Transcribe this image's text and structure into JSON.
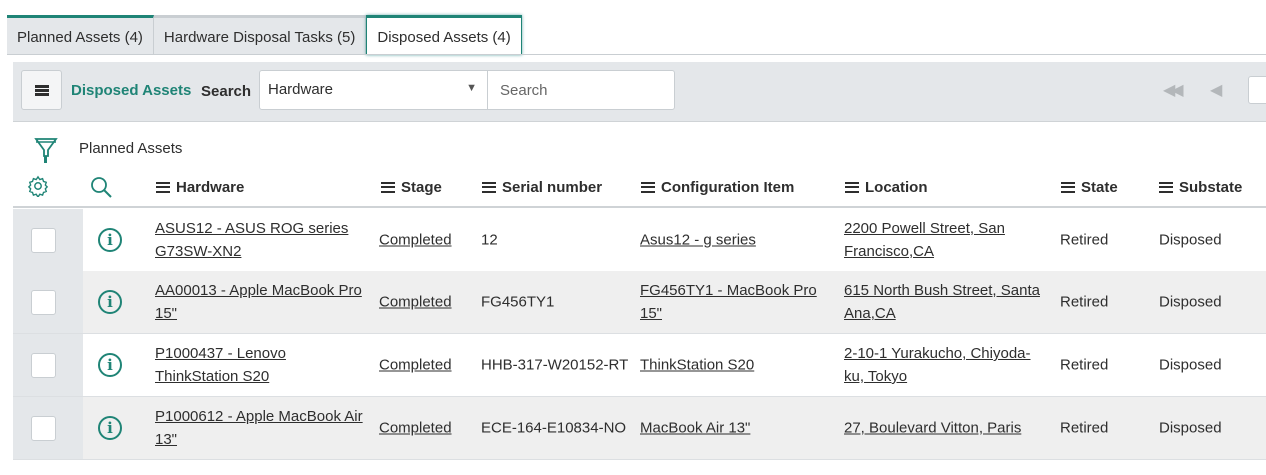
{
  "tabs": [
    {
      "label": "Planned Assets (4)"
    },
    {
      "label": "Hardware Disposal Tasks (5)"
    },
    {
      "label": "Disposed Assets (4)",
      "active": true
    }
  ],
  "toolbar": {
    "title": "Disposed Assets",
    "search_label": "Search",
    "field_select": "Hardware",
    "search_placeholder": "Search"
  },
  "filter": {
    "label": "Planned Assets"
  },
  "columns": [
    "Hardware",
    "Stage",
    "Serial number",
    "Configuration Item",
    "Location",
    "State",
    "Substate"
  ],
  "rows": [
    {
      "hardware": "ASUS12 - ASUS ROG series G73SW-XN2",
      "stage": "Completed",
      "serial": "12",
      "ci": "Asus12 - g series",
      "location": "2200 Powell Street, San Francisco,CA",
      "state": "Retired",
      "substate": "Disposed"
    },
    {
      "hardware": "AA00013 - Apple MacBook Pro 15\"",
      "stage": "Completed",
      "serial": "FG456TY1",
      "ci": "FG456TY1 - MacBook Pro 15\"",
      "location": "615 North Bush Street, Santa Ana,CA",
      "state": "Retired",
      "substate": "Disposed"
    },
    {
      "hardware": "P1000437 - Lenovo ThinkStation S20",
      "stage": "Completed",
      "serial": "HHB-317-W20152-RT",
      "ci": "ThinkStation S20",
      "location": "2-10-1 Yurakucho, Chiyoda-ku, Tokyo",
      "state": "Retired",
      "substate": "Disposed"
    },
    {
      "hardware": "P1000612 - Apple MacBook Air 13\"",
      "stage": "Completed",
      "serial": "ECE-164-E10834-NO",
      "ci": "MacBook Air 13\"",
      "location": "27, Boulevard Vitton, Paris",
      "state": "Retired",
      "substate": "Disposed"
    }
  ],
  "colors": {
    "accent": "#1f8476",
    "toolbar_bg": "#e4e7ea"
  }
}
